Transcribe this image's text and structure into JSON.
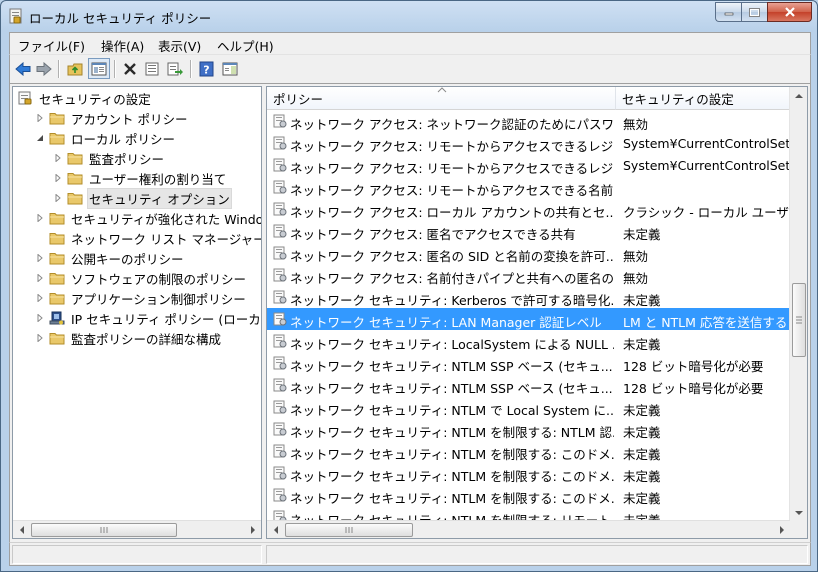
{
  "window": {
    "title": "ローカル セキュリティ ポリシー"
  },
  "menu": [
    {
      "label": "ファイル(F)"
    },
    {
      "label": "操作(A)"
    },
    {
      "label": "表示(V)"
    },
    {
      "label": "ヘルプ(H)"
    }
  ],
  "toolbar": {
    "buttons": [
      "back-icon",
      "forward-icon",
      "up-folder-icon",
      "show-tree-icon",
      "delete-icon",
      "properties-icon",
      "export-list-icon",
      "help-icon",
      "show-action-pane-icon"
    ]
  },
  "tree": {
    "items": [
      {
        "label": "セキュリティの設定",
        "icon": "security-settings-icon",
        "level": 0,
        "expander": ""
      },
      {
        "label": "アカウント ポリシー",
        "icon": "folder-icon",
        "level": 1,
        "expander": "collapsed"
      },
      {
        "label": "ローカル ポリシー",
        "icon": "folder-icon",
        "level": 1,
        "expander": "expanded"
      },
      {
        "label": "監査ポリシー",
        "icon": "folder-icon",
        "level": 2,
        "expander": "collapsed"
      },
      {
        "label": "ユーザー権利の割り当て",
        "icon": "folder-icon",
        "level": 2,
        "expander": "collapsed"
      },
      {
        "label": "セキュリティ オプション",
        "icon": "folder-icon",
        "level": 2,
        "expander": "collapsed",
        "selected": true
      },
      {
        "label": "セキュリティが強化された Windows",
        "icon": "folder-icon",
        "level": 1,
        "expander": "collapsed"
      },
      {
        "label": "ネットワーク リスト マネージャー ポ",
        "icon": "folder-icon",
        "level": 1,
        "expander": ""
      },
      {
        "label": "公開キーのポリシー",
        "icon": "folder-icon",
        "level": 1,
        "expander": "collapsed"
      },
      {
        "label": "ソフトウェアの制限のポリシー",
        "icon": "folder-icon",
        "level": 1,
        "expander": "collapsed"
      },
      {
        "label": "アプリケーション制御ポリシー",
        "icon": "folder-icon",
        "level": 1,
        "expander": "collapsed"
      },
      {
        "label": "IP セキュリティ ポリシー (ローカル",
        "icon": "ip-security-icon",
        "level": 1,
        "expander": "collapsed"
      },
      {
        "label": "監査ポリシーの詳細な構成",
        "icon": "folder-icon",
        "level": 1,
        "expander": "collapsed"
      }
    ]
  },
  "list": {
    "columns": [
      "ポリシー",
      "セキュリティの設定"
    ],
    "rows": [
      {
        "policy": "ネットワーク アクセス: ネットワーク認証のためにパスワ...",
        "setting": "無効"
      },
      {
        "policy": "ネットワーク アクセス: リモートからアクセスできるレジ...",
        "setting": "System¥CurrentControlSet¥Co"
      },
      {
        "policy": "ネットワーク アクセス: リモートからアクセスできるレジ...",
        "setting": "System¥CurrentControlSet¥Co"
      },
      {
        "policy": "ネットワーク アクセス: リモートからアクセスできる名前...",
        "setting": ""
      },
      {
        "policy": "ネットワーク アクセス: ローカル アカウントの共有とセ...",
        "setting": "クラシック - ローカル ユーザーが"
      },
      {
        "policy": "ネットワーク アクセス: 匿名でアクセスできる共有",
        "setting": "未定義"
      },
      {
        "policy": "ネットワーク アクセス: 匿名の SID と名前の変換を許可...",
        "setting": "無効"
      },
      {
        "policy": "ネットワーク アクセス: 名前付きパイプと共有への匿名の...",
        "setting": "無効"
      },
      {
        "policy": "ネットワーク セキュリティ: Kerberos で許可する暗号化...",
        "setting": "未定義"
      },
      {
        "policy": "ネットワーク セキュリティ: LAN Manager 認証レベル",
        "setting": "LM と NTLM 応答を送信する",
        "selected": true
      },
      {
        "policy": "ネットワーク セキュリティ: LocalSystem による NULL ...",
        "setting": "未定義"
      },
      {
        "policy": "ネットワーク セキュリティ: NTLM SSP ベース (セキュ...",
        "setting": "128 ビット暗号化が必要"
      },
      {
        "policy": "ネットワーク セキュリティ: NTLM SSP ベース (セキュ...",
        "setting": "128 ビット暗号化が必要"
      },
      {
        "policy": "ネットワーク セキュリティ: NTLM で Local System に...",
        "setting": "未定義"
      },
      {
        "policy": "ネットワーク セキュリティ: NTLM を制限する: NTLM 認...",
        "setting": "未定義"
      },
      {
        "policy": "ネットワーク セキュリティ: NTLM を制限する: このドメ...",
        "setting": "未定義"
      },
      {
        "policy": "ネットワーク セキュリティ: NTLM を制限する: このドメ...",
        "setting": "未定義"
      },
      {
        "policy": "ネットワーク セキュリティ: NTLM を制限する: このドメ...",
        "setting": "未定義"
      },
      {
        "policy": "ネットワーク セキュリティ: NTLM を制限する: リモート...",
        "setting": "未定義"
      }
    ]
  },
  "colors": {
    "selection": "#3399ff",
    "frame": "#b9d1ea"
  }
}
